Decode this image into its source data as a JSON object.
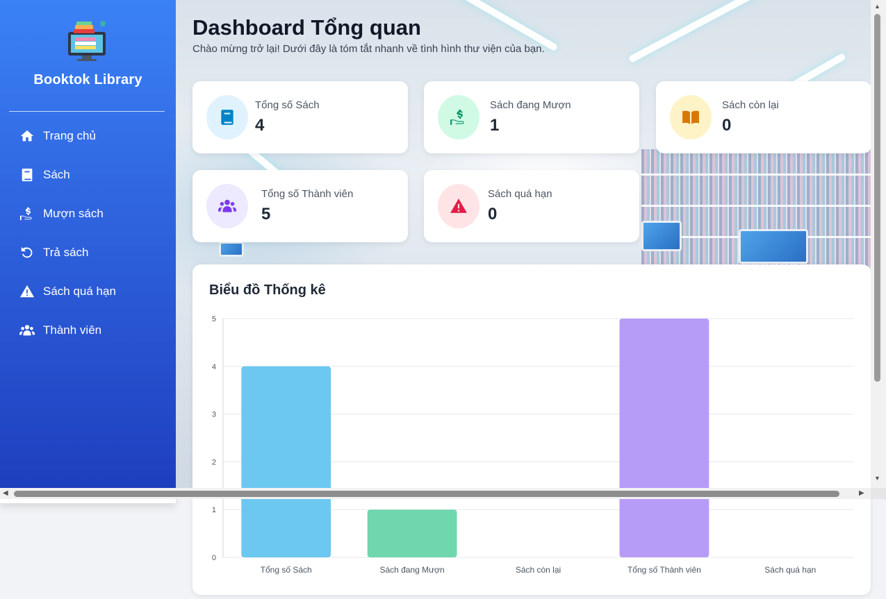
{
  "sidebar": {
    "brand": "Booktok Library",
    "logo_icon": "library-computer-logo",
    "items": [
      {
        "label": "Trang chủ",
        "icon": "home-icon"
      },
      {
        "label": "Sách",
        "icon": "book-icon"
      },
      {
        "label": "Mượn sách",
        "icon": "hand-dollar-icon"
      },
      {
        "label": "Trả sách",
        "icon": "undo-icon"
      },
      {
        "label": "Sách quá hạn",
        "icon": "warning-icon"
      },
      {
        "label": "Thành viên",
        "icon": "users-icon"
      }
    ]
  },
  "header": {
    "title": "Dashboard Tổng quan",
    "subtitle": "Chào mừng trở lại! Dưới đây là tóm tắt nhanh về tình hình thư viện của bạn."
  },
  "stats": [
    {
      "label": "Tổng số Sách",
      "value": "4",
      "icon": "book-icon",
      "color": "#0284c7",
      "bg": "#e0f2fe"
    },
    {
      "label": "Sách đang Mượn",
      "value": "1",
      "icon": "hand-dollar-icon",
      "color": "#059669",
      "bg": "#d1fae5"
    },
    {
      "label": "Sách còn lại",
      "value": "0",
      "icon": "open-book-icon",
      "color": "#d97706",
      "bg": "#fef3c7"
    },
    {
      "label": "Tổng số Thành viên",
      "value": "5",
      "icon": "users-icon",
      "color": "#7c3aed",
      "bg": "#ede9fe"
    },
    {
      "label": "Sách quá hạn",
      "value": "0",
      "icon": "warning-icon",
      "color": "#e11d48",
      "bg": "#ffe4e6"
    }
  ],
  "chart_panel": {
    "title": "Biểu đồ Thống kê"
  },
  "chart_data": {
    "type": "bar",
    "categories": [
      "Tổng số Sách",
      "Sách đang Mượn",
      "Sách còn lại",
      "Tổng số Thành viên",
      "Sách quá hạn"
    ],
    "values": [
      4,
      1,
      0,
      5,
      0
    ],
    "colors": [
      "#6cc8f0",
      "#6fd6ae",
      "#f6c453",
      "#b79cf7",
      "#f58a9a"
    ],
    "ylim": [
      0,
      5
    ],
    "yticks": [
      "0",
      "1",
      "2",
      "3",
      "4",
      "5"
    ],
    "grid": true,
    "title": "",
    "xlabel": "",
    "ylabel": ""
  }
}
